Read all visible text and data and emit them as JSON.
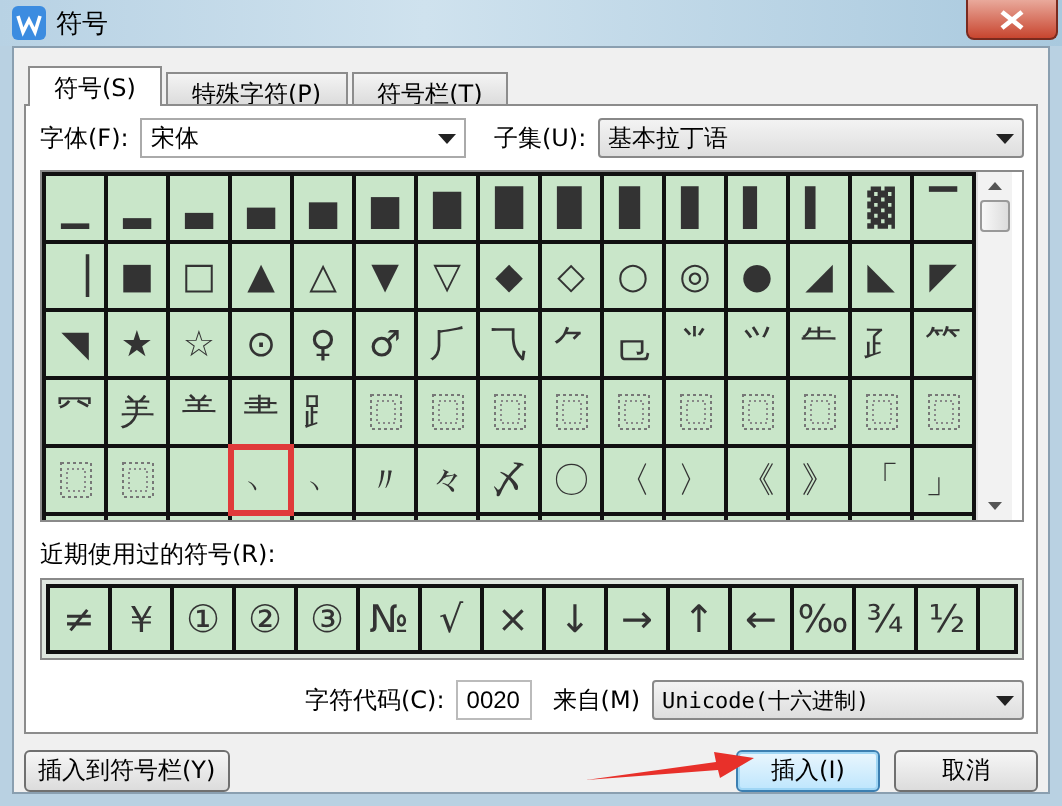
{
  "window": {
    "title": "符号"
  },
  "tabs": [
    {
      "label": "符号(S)",
      "selected": true
    },
    {
      "label": "特殊字符(P)",
      "selected": false
    },
    {
      "label": "符号栏(T)",
      "selected": false
    }
  ],
  "font": {
    "label": "字体(F):",
    "value": "宋体"
  },
  "subset": {
    "label": "子集(U):",
    "value": "基本拉丁语"
  },
  "symbol_grid": {
    "rows": [
      [
        {
          "kind": "glyph",
          "text": "▁",
          "marked": false
        },
        {
          "kind": "glyph",
          "text": "▂",
          "marked": false
        },
        {
          "kind": "glyph",
          "text": "▃",
          "marked": false
        },
        {
          "kind": "glyph",
          "text": "▄",
          "marked": false
        },
        {
          "kind": "glyph",
          "text": "▅",
          "marked": false
        },
        {
          "kind": "glyph",
          "text": "▆",
          "marked": false
        },
        {
          "kind": "glyph",
          "text": "▇",
          "marked": false
        },
        {
          "kind": "glyph",
          "text": "█",
          "marked": false
        },
        {
          "kind": "glyph",
          "text": "▉",
          "marked": false
        },
        {
          "kind": "glyph",
          "text": "▊",
          "marked": false
        },
        {
          "kind": "glyph",
          "text": "▋",
          "marked": false
        },
        {
          "kind": "glyph",
          "text": "▌",
          "marked": false
        },
        {
          "kind": "glyph",
          "text": "▍",
          "marked": false
        },
        {
          "kind": "glyph",
          "text": "▓",
          "marked": false
        },
        {
          "kind": "glyph",
          "text": "▔",
          "marked": false
        }
      ],
      [
        {
          "kind": "glyph",
          "text": "▕",
          "marked": false
        },
        {
          "kind": "glyph",
          "text": "■",
          "marked": false
        },
        {
          "kind": "glyph",
          "text": "□",
          "marked": false
        },
        {
          "kind": "glyph",
          "text": "▲",
          "marked": false
        },
        {
          "kind": "glyph",
          "text": "△",
          "marked": false
        },
        {
          "kind": "glyph",
          "text": "▼",
          "marked": false
        },
        {
          "kind": "glyph",
          "text": "▽",
          "marked": false
        },
        {
          "kind": "glyph",
          "text": "◆",
          "marked": false
        },
        {
          "kind": "glyph",
          "text": "◇",
          "marked": false
        },
        {
          "kind": "glyph",
          "text": "○",
          "marked": false
        },
        {
          "kind": "glyph",
          "text": "◎",
          "marked": false
        },
        {
          "kind": "glyph",
          "text": "●",
          "marked": false
        },
        {
          "kind": "glyph",
          "text": "◢",
          "marked": false
        },
        {
          "kind": "glyph",
          "text": "◣",
          "marked": false
        },
        {
          "kind": "glyph",
          "text": "◤",
          "marked": false
        }
      ],
      [
        {
          "kind": "glyph",
          "text": "◥",
          "marked": false
        },
        {
          "kind": "glyph",
          "text": "★",
          "marked": false
        },
        {
          "kind": "glyph",
          "text": "☆",
          "marked": false
        },
        {
          "kind": "glyph",
          "text": "⊙",
          "marked": false
        },
        {
          "kind": "glyph",
          "text": "♀",
          "marked": false
        },
        {
          "kind": "glyph",
          "text": "♂",
          "marked": false
        },
        {
          "kind": "glyph",
          "text": "⺁",
          "marked": false
        },
        {
          "kind": "glyph",
          "text": "⺄",
          "marked": false
        },
        {
          "kind": "glyph",
          "text": "⺈",
          "marked": false
        },
        {
          "kind": "glyph",
          "text": "⺋",
          "marked": false
        },
        {
          "kind": "glyph",
          "text": "⺌",
          "marked": false
        },
        {
          "kind": "glyph",
          "text": "⺍",
          "marked": false
        },
        {
          "kind": "glyph",
          "text": "⺧",
          "marked": false
        },
        {
          "kind": "glyph",
          "text": "⺪",
          "marked": false
        },
        {
          "kind": "glyph",
          "text": "⺮",
          "marked": false
        }
      ],
      [
        {
          "kind": "glyph",
          "text": "⺳",
          "marked": false
        },
        {
          "kind": "glyph",
          "text": "⺶",
          "marked": false
        },
        {
          "kind": "glyph",
          "text": "⺷",
          "marked": false
        },
        {
          "kind": "glyph",
          "text": "⺻",
          "marked": false
        },
        {
          "kind": "glyph",
          "text": "⻊",
          "marked": false
        },
        {
          "kind": "missing",
          "marked": false
        },
        {
          "kind": "missing",
          "marked": false
        },
        {
          "kind": "missing",
          "marked": false
        },
        {
          "kind": "missing",
          "marked": false
        },
        {
          "kind": "missing",
          "marked": false
        },
        {
          "kind": "missing",
          "marked": false
        },
        {
          "kind": "missing",
          "marked": false
        },
        {
          "kind": "missing",
          "marked": false
        },
        {
          "kind": "missing",
          "marked": false
        },
        {
          "kind": "missing",
          "marked": false
        }
      ],
      [
        {
          "kind": "missing",
          "marked": false
        },
        {
          "kind": "missing",
          "marked": false
        },
        {
          "kind": "empty",
          "marked": false
        },
        {
          "kind": "glyph",
          "text": "﹅",
          "marked": true
        },
        {
          "kind": "glyph",
          "text": "﹆",
          "marked": false
        },
        {
          "kind": "glyph",
          "text": "〃",
          "marked": false
        },
        {
          "kind": "glyph",
          "text": "々",
          "marked": false
        },
        {
          "kind": "glyph",
          "text": "〆",
          "marked": false
        },
        {
          "kind": "glyph",
          "text": "〇",
          "marked": false
        },
        {
          "kind": "glyph",
          "text": "〈",
          "marked": false
        },
        {
          "kind": "glyph",
          "text": "〉",
          "marked": false
        },
        {
          "kind": "glyph",
          "text": "《",
          "marked": false
        },
        {
          "kind": "glyph",
          "text": "》",
          "marked": false
        },
        {
          "kind": "glyph",
          "text": "「",
          "marked": false
        },
        {
          "kind": "glyph",
          "text": "」",
          "marked": false
        }
      ]
    ]
  },
  "recent": {
    "label": "近期使用过的符号(R):",
    "symbols": [
      "≠",
      "￥",
      "①",
      "②",
      "③",
      "№",
      "√",
      "×",
      "↓",
      "→",
      "↑",
      "←",
      "‰",
      "¾",
      "½"
    ]
  },
  "char_code": {
    "label": "字符代码(C):",
    "value": "0020"
  },
  "from": {
    "label": "来自(M)",
    "value": "Unicode(十六进制)"
  },
  "buttons": [
    {
      "label": "插入到符号栏(Y)",
      "kind": "secondary"
    },
    {
      "label": "插入(I)",
      "kind": "default"
    },
    {
      "label": "取消",
      "kind": "secondary"
    }
  ]
}
